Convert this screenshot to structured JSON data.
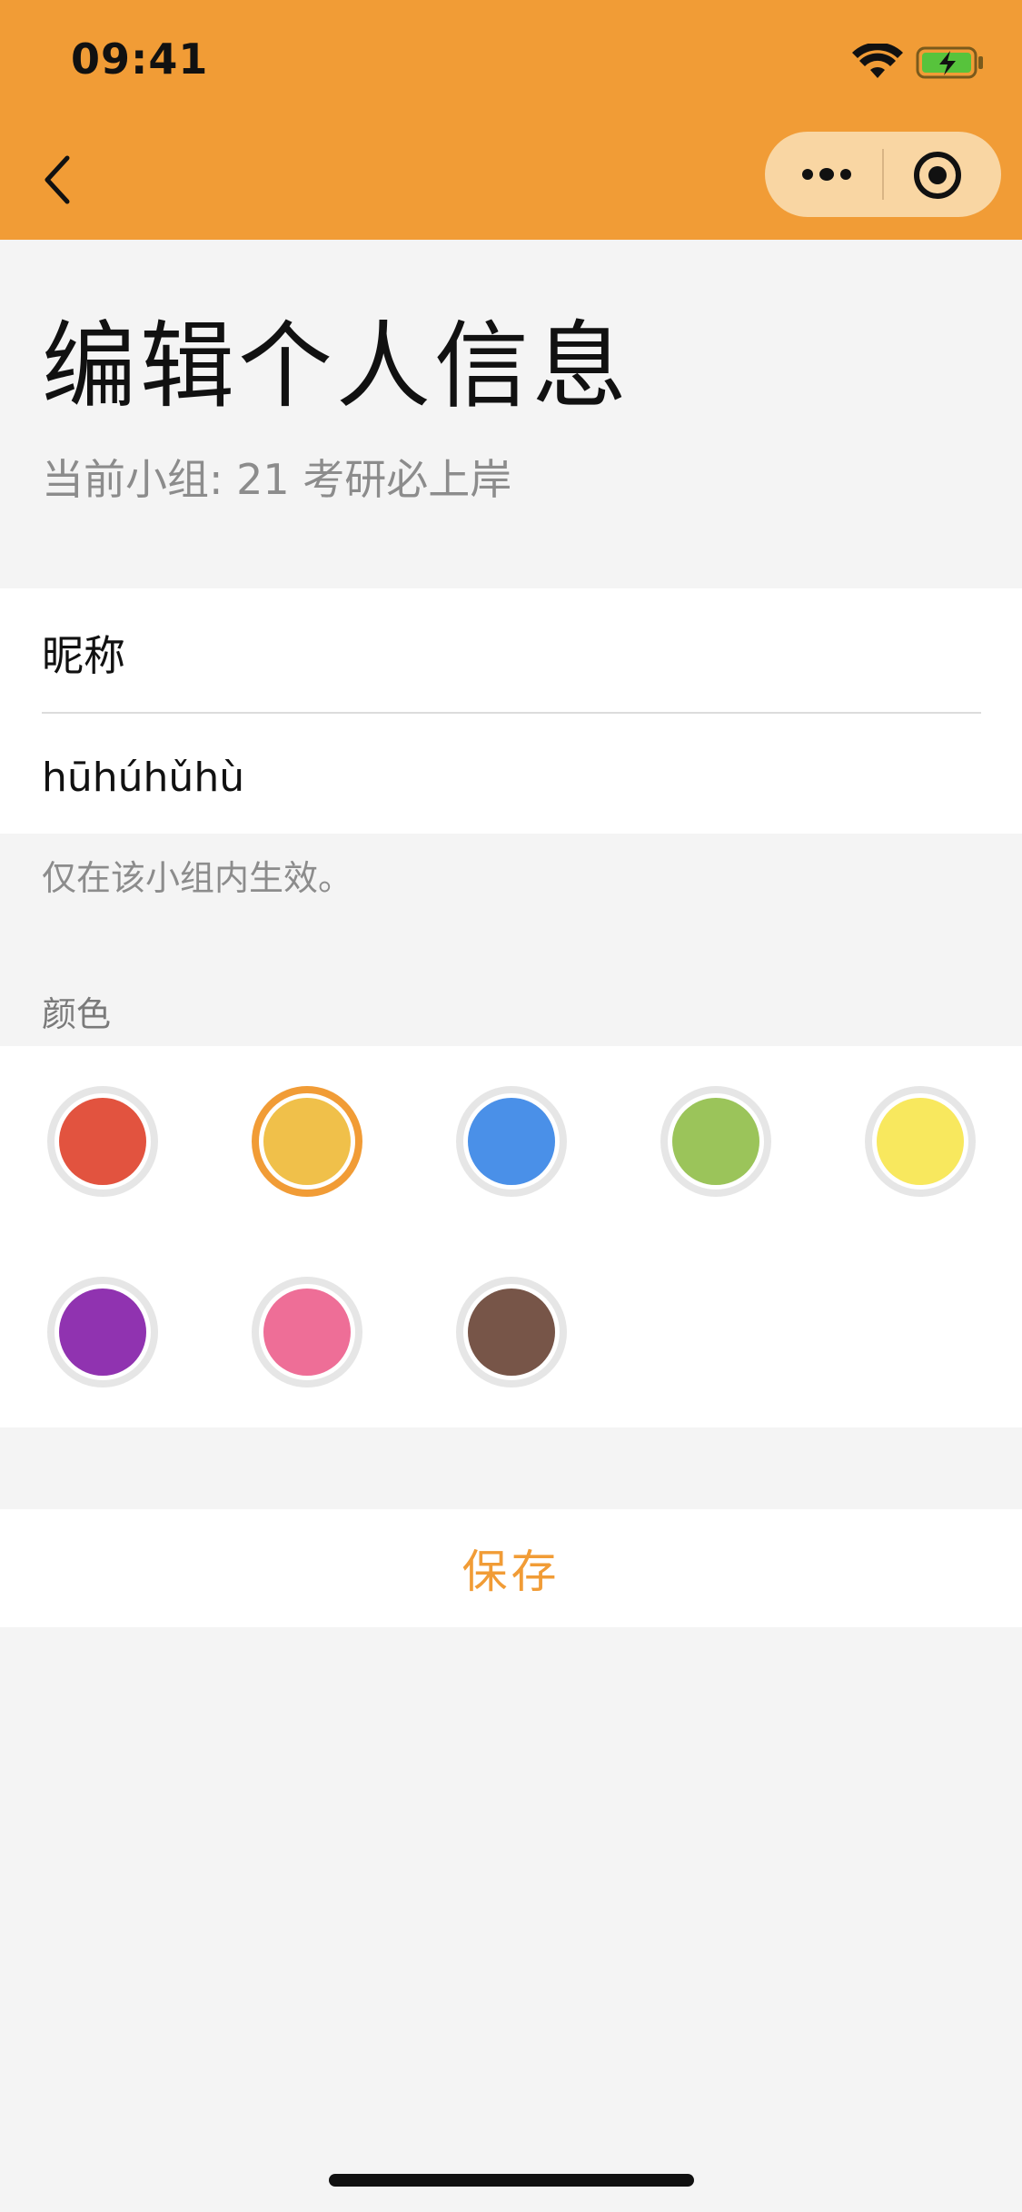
{
  "status_bar": {
    "time": "09:41",
    "wifi_icon": "wifi-icon",
    "battery_icon": "battery-charging-icon"
  },
  "nav": {
    "back_icon": "chevron-left-icon",
    "more_icon": "more-dots-icon",
    "close_icon": "target-circle-icon",
    "bar_color": "#f19c36",
    "capsule_color": "#f9d6a3"
  },
  "header": {
    "title": "编辑个人信息",
    "group_text": "当前小组: 21 考研必上岸"
  },
  "nickname": {
    "label": "昵称",
    "value": "hūhúhǔhù",
    "hint": "仅在该小组内生效。"
  },
  "colors": {
    "heading": "颜色",
    "selected_index": 1,
    "selected_ring": "#f19c36",
    "swatches": [
      "#e2533f",
      "#f0c04a",
      "#4a90e8",
      "#9bc45a",
      "#f8e85e",
      "#9033b0",
      "#ee6e97",
      "#775548"
    ]
  },
  "actions": {
    "save_label": "保存"
  }
}
